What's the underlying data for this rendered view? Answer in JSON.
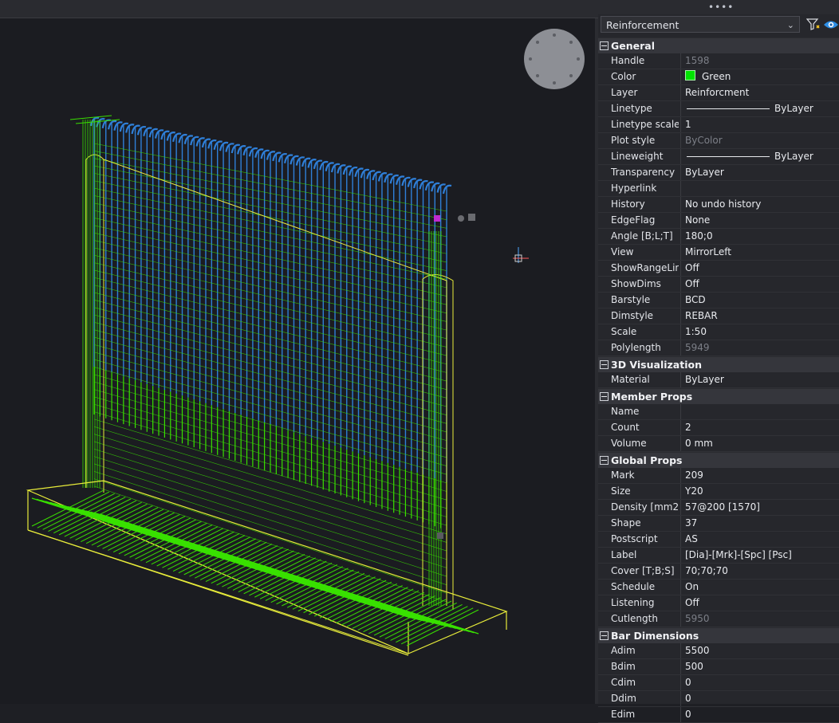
{
  "panel": {
    "selector_value": "Reinforcement",
    "selector_options_visible": [
      "Reinforcement"
    ]
  },
  "icons": {
    "filter": "quick-select-filter-icon",
    "eye": "visibility-eye-icon",
    "nav_wheel": "navigation-wheel-icon",
    "ucs": "ucs-axis-icon"
  },
  "colors": {
    "rebar_blue": "#2f7fd8",
    "rebar_green": "#39e000",
    "outline_yellow": "#e8ec3a",
    "color_swatch": "#00e400"
  },
  "sections": [
    {
      "title": "General",
      "rows": [
        {
          "key": "Handle",
          "value": "1598",
          "dim": true
        },
        {
          "key": "Color",
          "value": "Green",
          "swatch": true
        },
        {
          "key": "Layer",
          "value": "Reinforcment"
        },
        {
          "key": "Linetype",
          "value": "ByLayer",
          "line": true
        },
        {
          "key": "Linetype scale",
          "value": "1"
        },
        {
          "key": "Plot style",
          "value": "ByColor",
          "dim": true
        },
        {
          "key": "Lineweight",
          "value": "ByLayer",
          "line": true
        },
        {
          "key": "Transparency",
          "value": "ByLayer"
        },
        {
          "key": "Hyperlink",
          "value": ""
        },
        {
          "key": "History",
          "value": "No undo history"
        },
        {
          "key": "EdgeFlag",
          "value": "None"
        },
        {
          "key": "Angle [B;L;T]",
          "value": "180;0"
        },
        {
          "key": "View",
          "value": "MirrorLeft"
        },
        {
          "key": "ShowRangeLine",
          "value": "Off"
        },
        {
          "key": "ShowDims",
          "value": "Off"
        },
        {
          "key": "Barstyle",
          "value": "BCD"
        },
        {
          "key": "Dimstyle",
          "value": "REBAR"
        },
        {
          "key": "Scale",
          "value": "1:50"
        },
        {
          "key": "Polylength",
          "value": "5949",
          "dim": true
        }
      ]
    },
    {
      "title": "3D Visualization",
      "rows": [
        {
          "key": "Material",
          "value": "ByLayer"
        }
      ]
    },
    {
      "title": "Member Props",
      "rows": [
        {
          "key": "Name",
          "value": ""
        },
        {
          "key": "Count",
          "value": "2"
        },
        {
          "key": "Volume",
          "value": "0 mm"
        }
      ]
    },
    {
      "title": "Global Props",
      "rows": [
        {
          "key": "Mark",
          "value": "209"
        },
        {
          "key": "Size",
          "value": "Y20"
        },
        {
          "key": "Density [mm2]",
          "value": "57@200 [1570]"
        },
        {
          "key": "Shape",
          "value": "37"
        },
        {
          "key": "Postscript",
          "value": "AS"
        },
        {
          "key": "Label",
          "value": "[Dia]-[Mrk]-[Spc] [Psc]"
        },
        {
          "key": "Cover [T;B;S]",
          "value": "70;70;70"
        },
        {
          "key": "Schedule",
          "value": "On"
        },
        {
          "key": "Listening",
          "value": "Off"
        },
        {
          "key": "Cutlength",
          "value": "5950",
          "dim": true
        }
      ]
    },
    {
      "title": "Bar Dimensions",
      "rows": [
        {
          "key": "Adim",
          "value": "5500"
        },
        {
          "key": "Bdim",
          "value": "500"
        },
        {
          "key": "Cdim",
          "value": "0"
        },
        {
          "key": "Ddim",
          "value": "0"
        },
        {
          "key": "Edim",
          "value": "0"
        }
      ]
    }
  ]
}
